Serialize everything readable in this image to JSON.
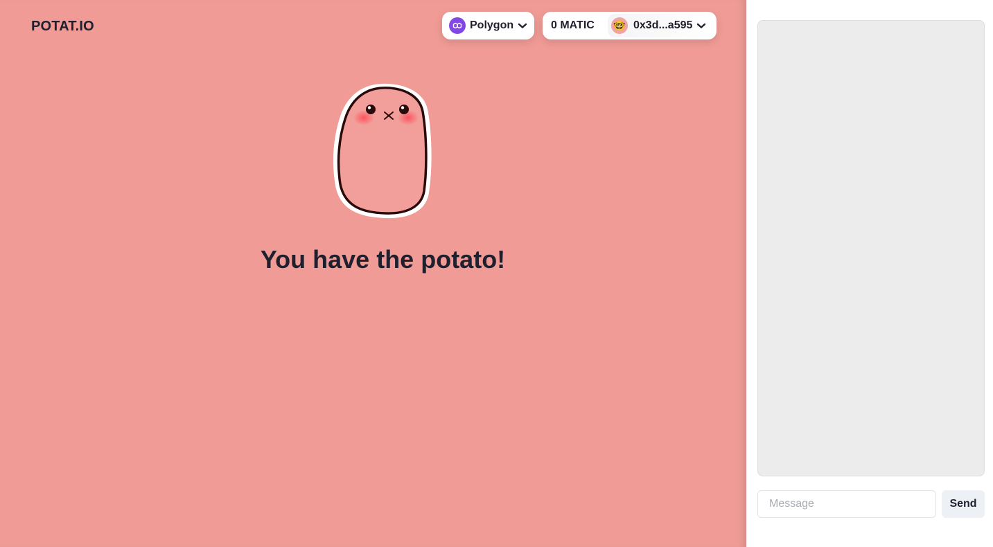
{
  "header": {
    "logo": "POTAT.IO",
    "chain": {
      "label": "Polygon",
      "icon": "polygon-icon",
      "color": "#8247e5"
    },
    "balance": "0 MATIC",
    "account": {
      "address": "0x3d...a595",
      "avatar": "🤓"
    }
  },
  "main": {
    "background": "#f09b96",
    "mascot": "potato-illustration",
    "status": "You have the potato!"
  },
  "chat": {
    "input_placeholder": "Message",
    "send_label": "Send"
  }
}
